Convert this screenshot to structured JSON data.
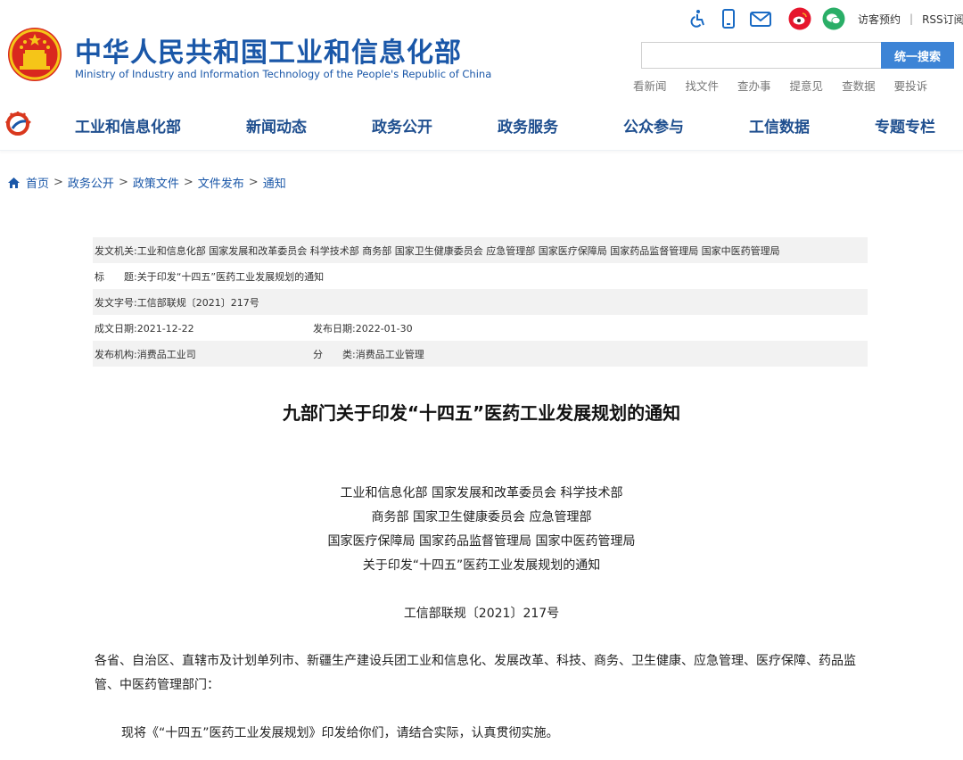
{
  "header": {
    "title_cn": "中华人民共和国工业和信息化部",
    "title_en": "Ministry of Industry and Information Technology of the People's Republic of China",
    "icons": [
      "accessibility-icon",
      "mobile-icon",
      "mail-icon",
      "weibo-icon",
      "wechat-icon"
    ],
    "visitor_link": "访客预约",
    "separator": "|",
    "rss_link": "RSS订阅",
    "search": {
      "placeholder": "",
      "button": "统一搜索"
    },
    "quick_links": [
      "看新闻",
      "找文件",
      "查办事",
      "提意见",
      "查数据",
      "要投诉"
    ]
  },
  "nav": {
    "items": [
      "工业和信息化部",
      "新闻动态",
      "政务公开",
      "政务服务",
      "公众参与",
      "工信数据",
      "专题专栏"
    ]
  },
  "breadcrumb": {
    "items": [
      "首页",
      "政务公开",
      "政策文件",
      "文件发布",
      "通知"
    ],
    "separator": ">"
  },
  "meta": {
    "issuer_label": "发文机关:",
    "issuer": "工业和信息化部 国家发展和改革委员会 科学技术部 商务部 国家卫生健康委员会 应急管理部 国家医疗保障局 国家药品监督管理局 国家中医药管理局",
    "title_label": "标　　题:",
    "title": "关于印发“十四五”医药工业发展规划的通知",
    "doc_no_label": "发文字号:",
    "doc_no": "工信部联规〔2021〕217号",
    "created_label": "成文日期:",
    "created": "2021-12-22",
    "published_label": "发布日期:",
    "published": "2022-01-30",
    "agency_label": "发布机构:",
    "agency": "消费品工业司",
    "category_label": "分　　类:",
    "category": "消费品工业管理"
  },
  "document": {
    "title": "九部门关于印发“十四五”医药工业发展规划的通知",
    "issuers": [
      "工业和信息化部 国家发展和改革委员会 科学技术部",
      "商务部 国家卫生健康委员会 应急管理部",
      "国家医疗保障局 国家药品监督管理局 国家中医药管理局",
      "关于印发“十四五”医药工业发展规划的通知"
    ],
    "doc_no": "工信部联规〔2021〕217号",
    "recipients": "各省、自治区、直辖市及计划单列市、新疆生产建设兵团工业和信息化、发展改革、科技、商务、卫生健康、应急管理、医疗保障、药品监管、中医药管理部门：",
    "body": "现将《“十四五”医药工业发展规划》印发给你们，请结合实际，认真贯彻实施。"
  },
  "colors": {
    "brand_blue": "#1a57a8",
    "nav_text": "#1f4f8f",
    "search_button": "#3d84d6",
    "meta_shade": "#f2f2f2"
  }
}
